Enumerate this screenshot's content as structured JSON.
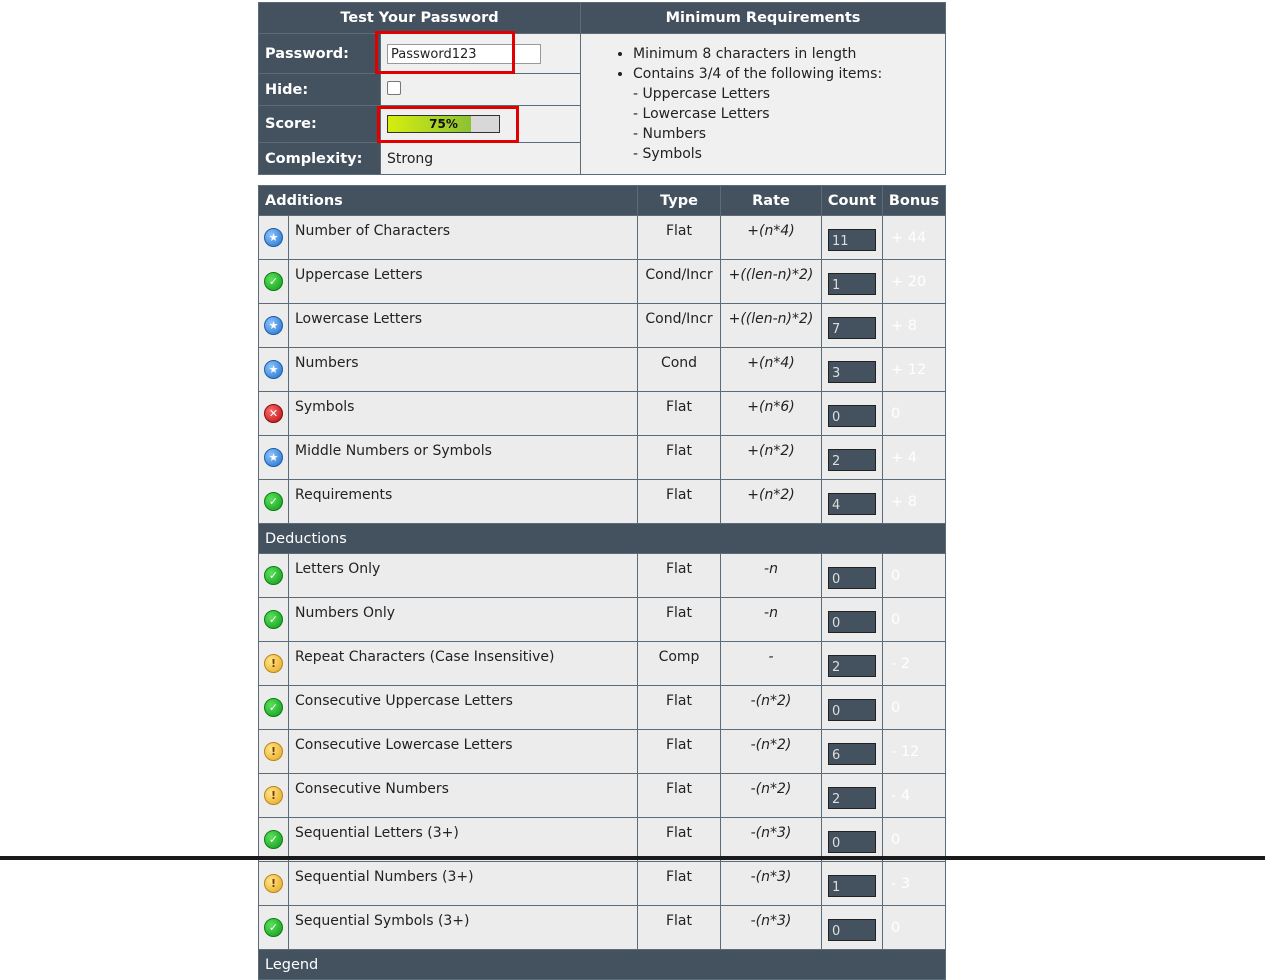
{
  "top": {
    "test_header": "Test Your Password",
    "req_header": "Minimum Requirements",
    "password_label": "Password:",
    "password_value": "Password123",
    "hide_label": "Hide:",
    "score_label": "Score:",
    "score_text": "75%",
    "score_fraction": 0.75,
    "complexity_label": "Complexity:",
    "complexity_value": "Strong",
    "requirements": [
      "Minimum 8 characters in length",
      "Contains 3/4 of the following items:"
    ],
    "sub_requirements": [
      "- Uppercase Letters",
      "- Lowercase Letters",
      "- Numbers",
      "- Symbols"
    ]
  },
  "table": {
    "headers": {
      "additions": "Additions",
      "type": "Type",
      "rate": "Rate",
      "count": "Count",
      "bonus": "Bonus"
    },
    "deductions_label": "Deductions",
    "legend_label": "Legend",
    "additions": [
      {
        "icon": "star",
        "name": "Number of Characters",
        "type": "Flat",
        "rate": "+(n*4)",
        "count": "11",
        "bonus": "+ 44",
        "color": "blue"
      },
      {
        "icon": "check",
        "name": "Uppercase Letters",
        "type": "Cond/Incr",
        "rate": "+((len-n)*2)",
        "count": "1",
        "bonus": "+ 20",
        "color": "green"
      },
      {
        "icon": "star",
        "name": "Lowercase Letters",
        "type": "Cond/Incr",
        "rate": "+((len-n)*2)",
        "count": "7",
        "bonus": "+ 8",
        "color": "blue"
      },
      {
        "icon": "star",
        "name": "Numbers",
        "type": "Cond",
        "rate": "+(n*4)",
        "count": "3",
        "bonus": "+ 12",
        "color": "blue"
      },
      {
        "icon": "x",
        "name": "Symbols",
        "type": "Flat",
        "rate": "+(n*6)",
        "count": "0",
        "bonus": "0",
        "color": "red"
      },
      {
        "icon": "star",
        "name": "Middle Numbers or Symbols",
        "type": "Flat",
        "rate": "+(n*2)",
        "count": "2",
        "bonus": "+ 4",
        "color": "blue"
      },
      {
        "icon": "check",
        "name": "Requirements",
        "type": "Flat",
        "rate": "+(n*2)",
        "count": "4",
        "bonus": "+ 8",
        "color": "green"
      }
    ],
    "deductions": [
      {
        "icon": "check",
        "name": "Letters Only",
        "type": "Flat",
        "rate": "-n",
        "count": "0",
        "bonus": "0",
        "color": "green"
      },
      {
        "icon": "check",
        "name": "Numbers Only",
        "type": "Flat",
        "rate": "-n",
        "count": "0",
        "bonus": "0",
        "color": "green"
      },
      {
        "icon": "warn",
        "name": "Repeat Characters (Case Insensitive)",
        "type": "Comp",
        "rate": "-",
        "count": "2",
        "bonus": "- 2",
        "color": "orange"
      },
      {
        "icon": "check",
        "name": "Consecutive Uppercase Letters",
        "type": "Flat",
        "rate": "-(n*2)",
        "count": "0",
        "bonus": "0",
        "color": "green"
      },
      {
        "icon": "warn",
        "name": "Consecutive Lowercase Letters",
        "type": "Flat",
        "rate": "-(n*2)",
        "count": "6",
        "bonus": "- 12",
        "color": "orange"
      },
      {
        "icon": "warn",
        "name": "Consecutive Numbers",
        "type": "Flat",
        "rate": "-(n*2)",
        "count": "2",
        "bonus": "- 4",
        "color": "orange"
      },
      {
        "icon": "check",
        "name": "Sequential Letters (3+)",
        "type": "Flat",
        "rate": "-(n*3)",
        "count": "0",
        "bonus": "0",
        "color": "green"
      },
      {
        "icon": "warn",
        "name": "Sequential Numbers (3+)",
        "type": "Flat",
        "rate": "-(n*3)",
        "count": "1",
        "bonus": "- 3",
        "color": "orange"
      },
      {
        "icon": "check",
        "name": "Sequential Symbols (3+)",
        "type": "Flat",
        "rate": "-(n*3)",
        "count": "0",
        "bonus": "0",
        "color": "green"
      }
    ]
  }
}
